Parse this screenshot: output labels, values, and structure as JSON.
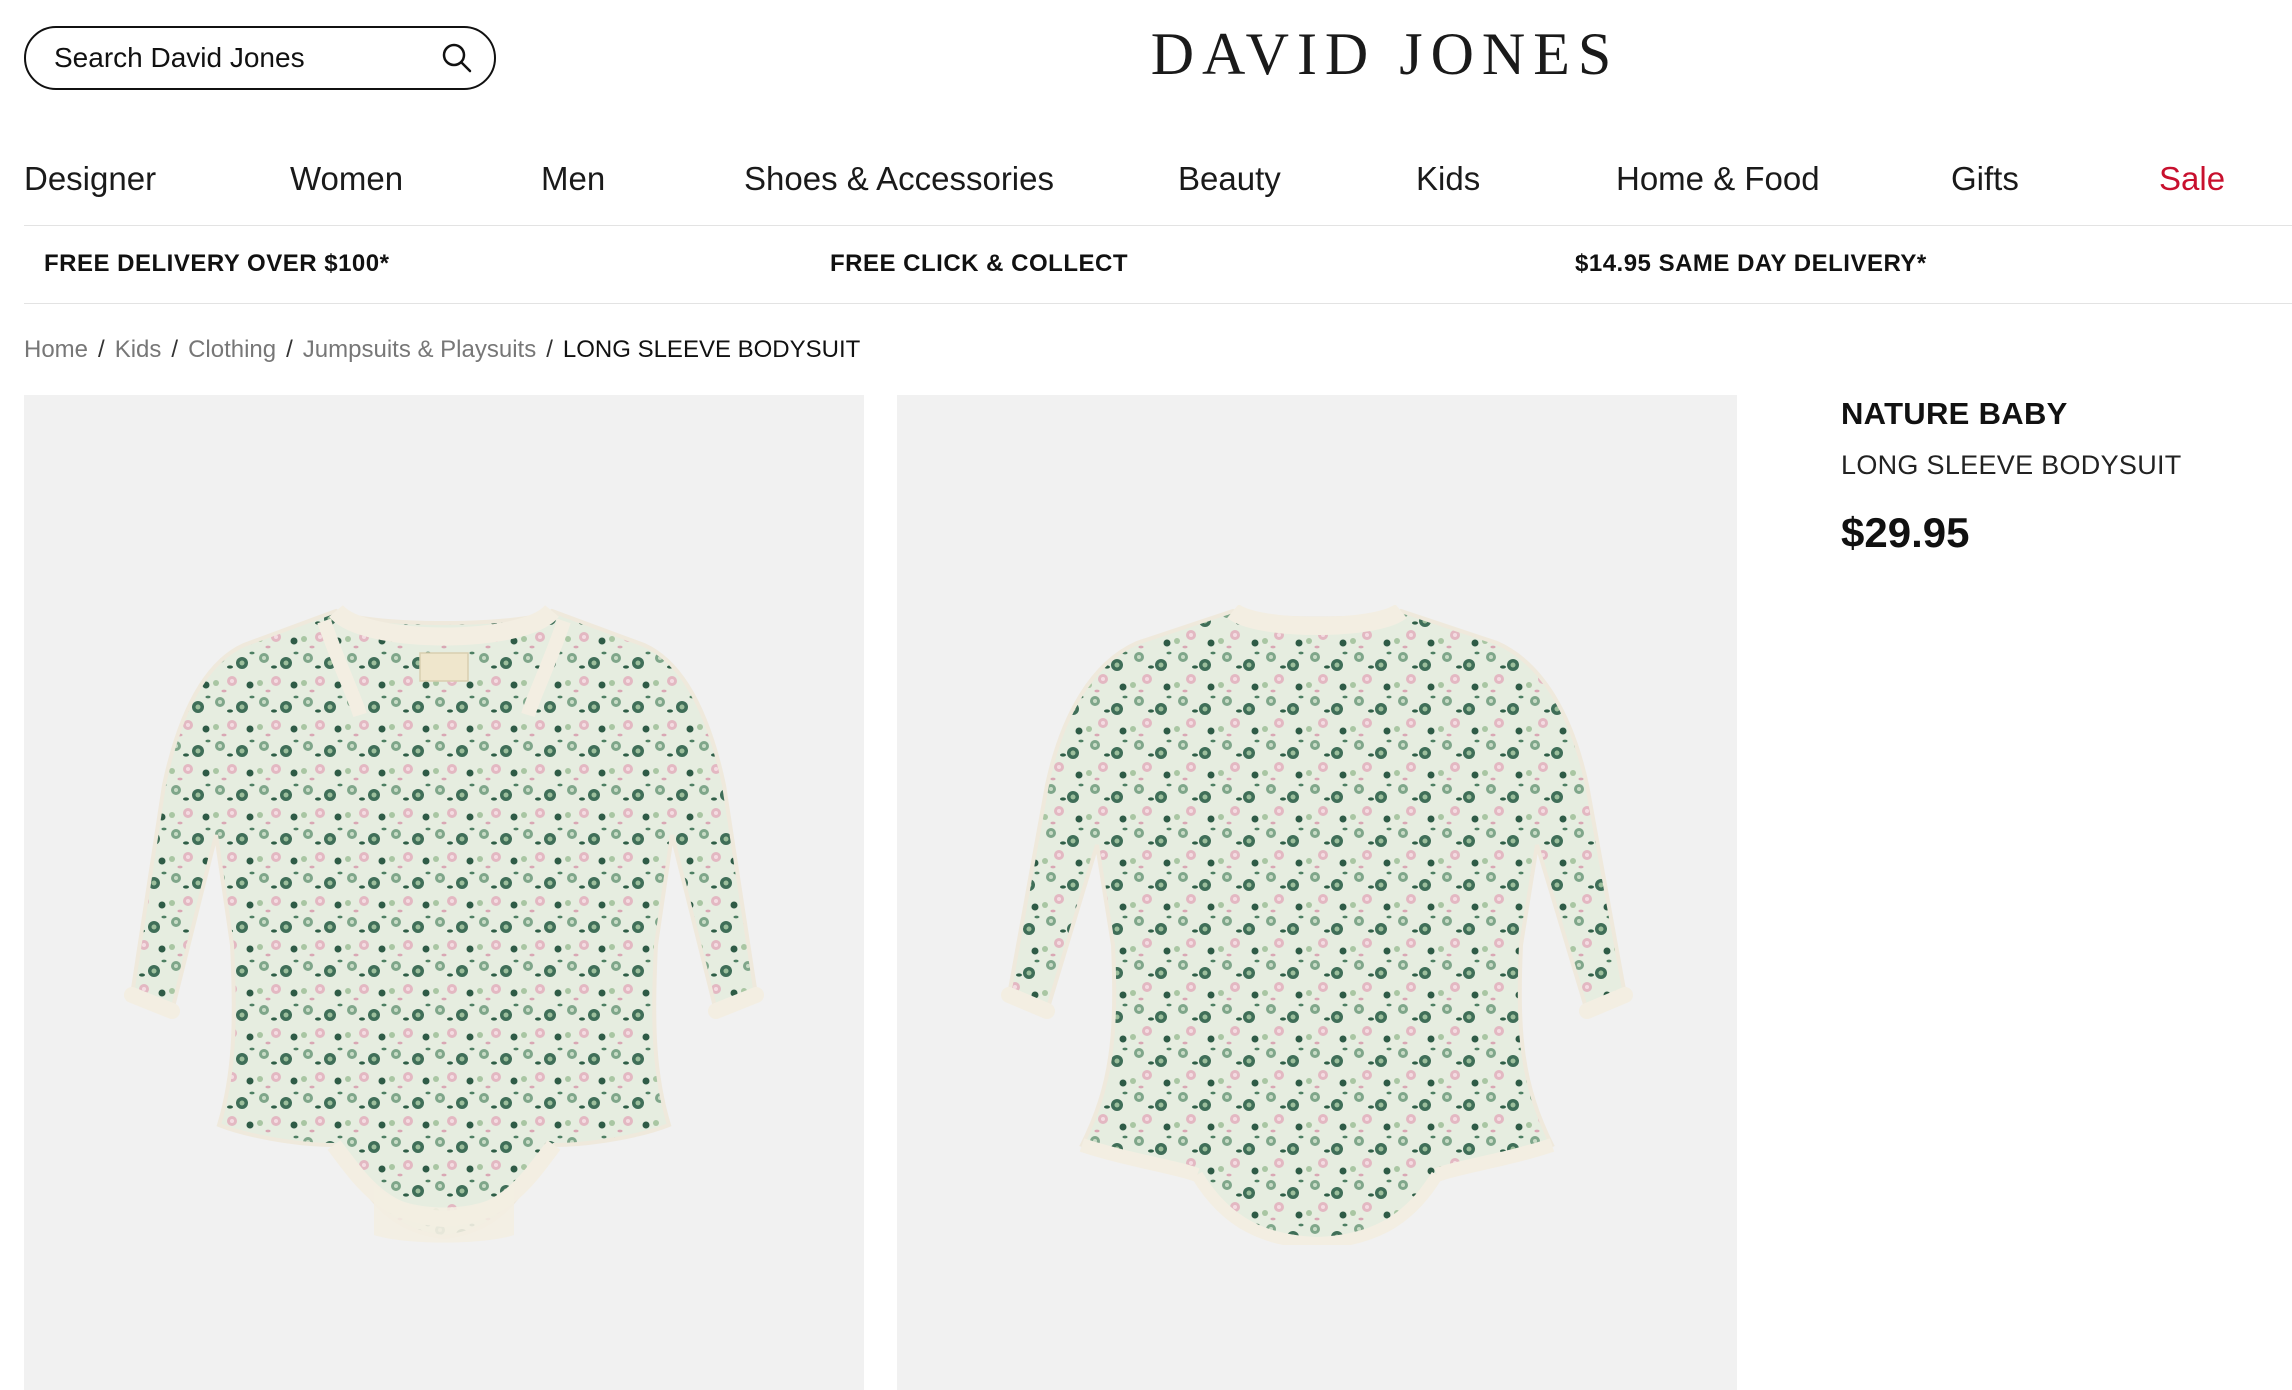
{
  "header": {
    "search_placeholder": "Search David Jones",
    "logo": "DAVID JONES"
  },
  "nav": {
    "items": [
      {
        "label": "Designer"
      },
      {
        "label": "Women"
      },
      {
        "label": "Men"
      },
      {
        "label": "Shoes & Accessories"
      },
      {
        "label": "Beauty"
      },
      {
        "label": "Kids"
      },
      {
        "label": "Home & Food"
      },
      {
        "label": "Gifts"
      },
      {
        "label": "Sale"
      }
    ],
    "sale_color": "#c8102e"
  },
  "promo": {
    "items": [
      {
        "label": "FREE DELIVERY OVER $100*"
      },
      {
        "label": "FREE CLICK & COLLECT"
      },
      {
        "label": "$14.95 SAME DAY DELIVERY*"
      }
    ]
  },
  "breadcrumb": {
    "items": [
      {
        "label": "Home"
      },
      {
        "label": "Kids"
      },
      {
        "label": "Clothing"
      },
      {
        "label": "Jumpsuits & Playsuits"
      }
    ],
    "separator": "/",
    "current": "LONG SLEEVE BODYSUIT"
  },
  "product": {
    "brand": "NATURE BABY",
    "name": "LONG SLEEVE BODYSUIT",
    "price": "$29.95",
    "images": [
      {
        "icon": "bodysuit-front-image"
      },
      {
        "icon": "bodysuit-back-image"
      }
    ]
  }
}
